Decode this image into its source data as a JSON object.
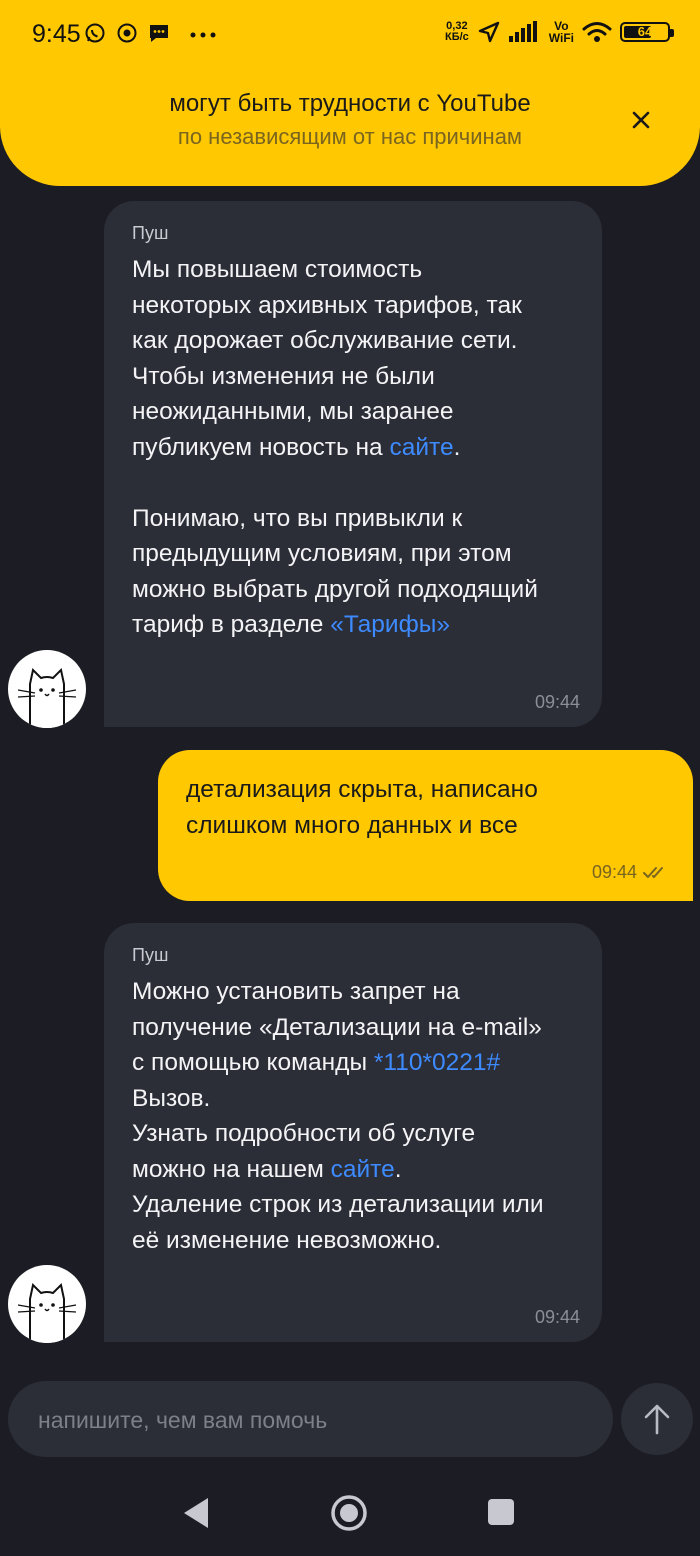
{
  "status_bar": {
    "time": "9:45",
    "speed_value": "0,32",
    "speed_unit": "КБ/с",
    "vowifi_line1": "Vo",
    "vowifi_line2": "WiFi",
    "battery": "64",
    "battery_level": 0.64
  },
  "banner": {
    "title": "могут быть трудности с YouTube",
    "subtitle": "по независящим от нас причинам"
  },
  "messages": [
    {
      "sender": "Пуш",
      "text_before_link": "Мы повышаем стоимость\nнекоторых архивных тарифов, так\nкак дорожает обслуживание сети.\nЧтобы изменения не были\nнеожиданными, мы заранее\nпубликуем новость на ",
      "link1": "сайте",
      "text_after_link": ".\n\nПонимаю, что вы привыкли к\nпредыдущим условиям, при этом\nможно выбрать другой подходящий\nтариф в разделе ",
      "link2": "«Тарифы»",
      "time": "09:44"
    },
    {
      "text": "детализация скрыта, написано\nслишком много данных и все",
      "time": "09:44"
    },
    {
      "sender": "Пуш",
      "text_before_link": "Можно установить запрет на\nполучение «Детализации на e-mail»\nс помощью команды ",
      "link1": "*110*0221#",
      "text_middle": "\nВызов.\nУзнать подробности об услуге\nможно на нашем ",
      "link2": "сайте",
      "text_after_link": ".\nУдаление строк из детализации или\nеё изменение невозможно.",
      "time": "09:44"
    }
  ],
  "composer": {
    "placeholder": "напишите, чем вам помочь"
  },
  "colors": {
    "accent": "#ffc800",
    "background": "#1c1d24",
    "bubble": "#2b2d37",
    "link": "#3d8bff"
  }
}
